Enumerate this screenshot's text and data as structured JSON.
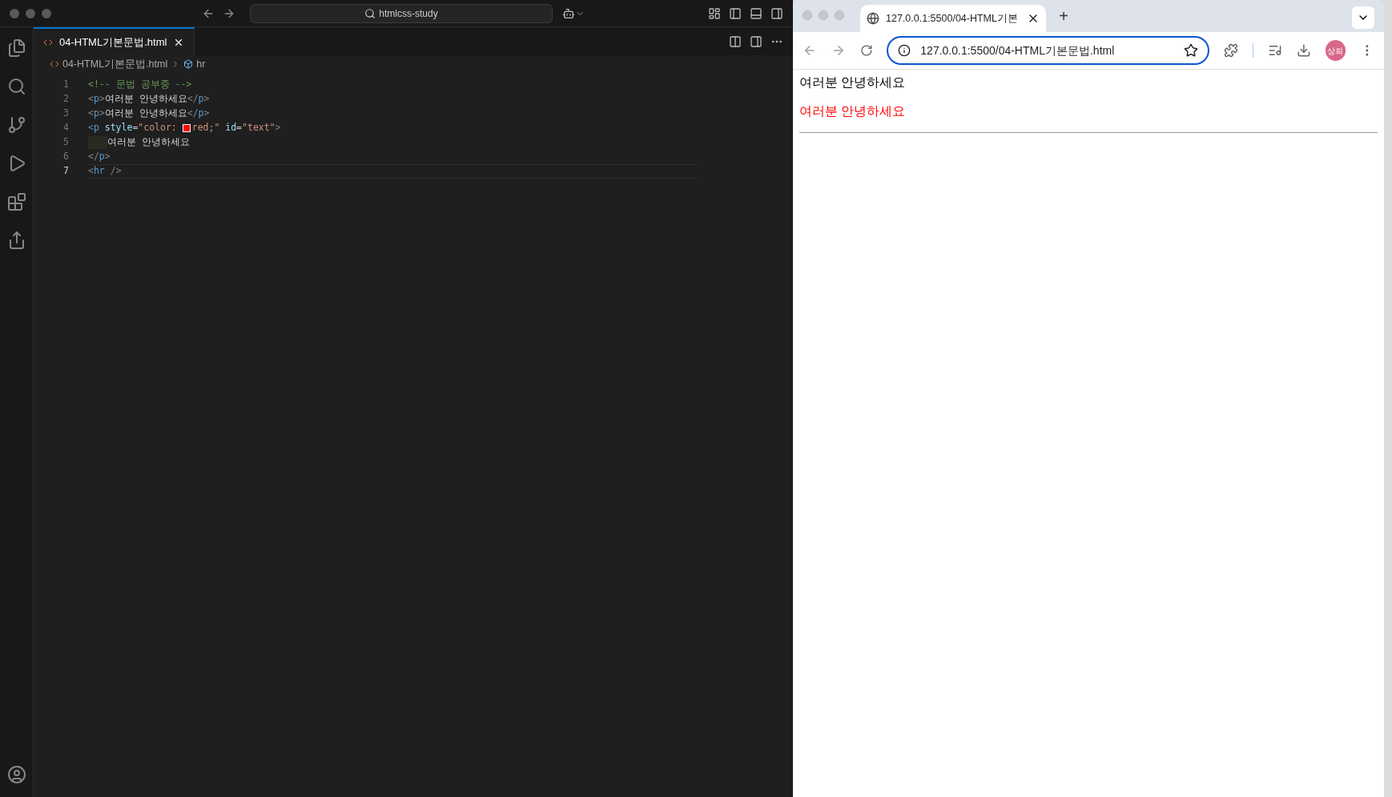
{
  "editor": {
    "search": "htmlcss-study",
    "tabs": [
      {
        "label": "04-HTML기본문법.html",
        "selected": true
      }
    ],
    "breadcrumb": [
      "04-HTML기본문법.html",
      "hr"
    ],
    "lines": [
      {
        "number": "1",
        "current": false,
        "tokens": [
          {
            "kind": "comment",
            "text": "<!-- 문법 공부중 -->"
          }
        ]
      },
      {
        "number": "2",
        "current": false,
        "tokens": [
          {
            "kind": "punct",
            "text": "<"
          },
          {
            "kind": "tag",
            "text": "p"
          },
          {
            "kind": "punct",
            "text": ">"
          },
          {
            "kind": "text",
            "text": "여러분 안녕하세요"
          },
          {
            "kind": "punct",
            "text": "</"
          },
          {
            "kind": "tag",
            "text": "p"
          },
          {
            "kind": "punct",
            "text": ">"
          }
        ]
      },
      {
        "number": "3",
        "current": false,
        "tokens": [
          {
            "kind": "punct",
            "text": "<"
          },
          {
            "kind": "tag",
            "text": "p"
          },
          {
            "kind": "punct",
            "text": ">"
          },
          {
            "kind": "text",
            "text": "여러분 안녕하세요"
          },
          {
            "kind": "punct",
            "text": "</"
          },
          {
            "kind": "tag",
            "text": "p"
          },
          {
            "kind": "punct",
            "text": ">"
          }
        ]
      },
      {
        "number": "4",
        "current": false,
        "tokens": [
          {
            "kind": "punct",
            "text": "<"
          },
          {
            "kind": "tag",
            "text": "p"
          },
          {
            "kind": "space"
          },
          {
            "kind": "attr",
            "text": "style"
          },
          {
            "kind": "text",
            "text": "="
          },
          {
            "kind": "string",
            "text": "\"color: "
          },
          {
            "kind": "swatch",
            "color": "#ff0000"
          },
          {
            "kind": "string",
            "text": "red;\""
          },
          {
            "kind": "space"
          },
          {
            "kind": "attr",
            "text": "id"
          },
          {
            "kind": "text",
            "text": "="
          },
          {
            "kind": "string",
            "text": "\"text\""
          },
          {
            "kind": "punct",
            "text": ">"
          }
        ]
      },
      {
        "number": "5",
        "current": false,
        "tokens": [
          {
            "kind": "indent"
          },
          {
            "kind": "text",
            "text": "여러분 안녕하세요"
          }
        ]
      },
      {
        "number": "6",
        "current": false,
        "tokens": [
          {
            "kind": "punct",
            "text": "</"
          },
          {
            "kind": "tag",
            "text": "p"
          },
          {
            "kind": "punct",
            "text": ">"
          }
        ]
      },
      {
        "number": "7",
        "current": true,
        "tokens": [
          {
            "kind": "punct",
            "text": "<"
          },
          {
            "kind": "tag",
            "text": "hr"
          },
          {
            "kind": "punct",
            "text": " />"
          }
        ]
      }
    ]
  },
  "browser": {
    "tabs": [
      {
        "label": "127.0.0.1:5500/04-HTML기본",
        "selected": true
      }
    ],
    "new_tab": "+",
    "url": "127.0.0.1:5500/04-HTML기본문법.html",
    "avatar": "상희",
    "content": [
      {
        "kind": "paragraph",
        "text": "여러분 안녕하세요",
        "color": "#000000"
      },
      {
        "kind": "paragraph",
        "text": "여러분 안녕하세요",
        "color": "#ff0000"
      },
      {
        "kind": "rule"
      }
    ]
  }
}
